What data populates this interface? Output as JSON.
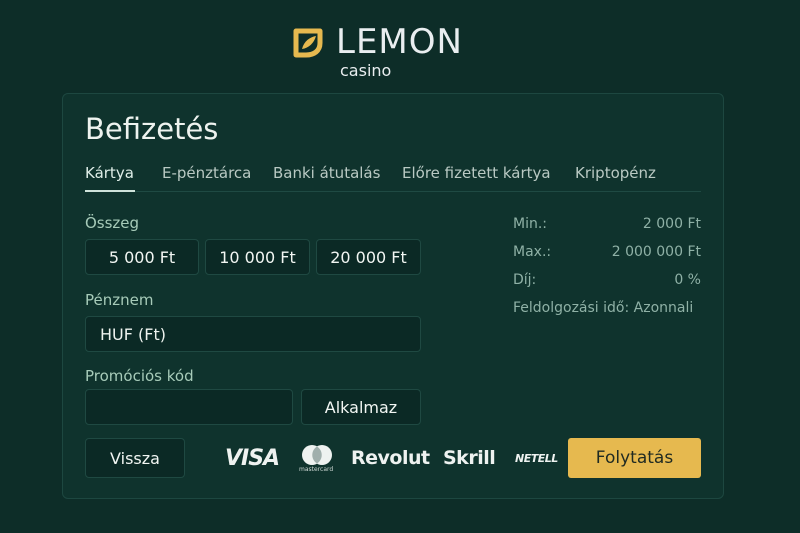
{
  "brand": {
    "name": "LEMON",
    "sub": "casino",
    "accent": "#e6b94f"
  },
  "page": {
    "title": "Befizetés"
  },
  "tabs": [
    {
      "label": "Kártya",
      "active": true
    },
    {
      "label": "E-pénztárca",
      "active": false
    },
    {
      "label": "Banki átutalás",
      "active": false
    },
    {
      "label": "Előre fizetett kártya",
      "active": false
    },
    {
      "label": "Kriptopénz",
      "active": false
    }
  ],
  "amount": {
    "label": "Összeg",
    "options": [
      "5 000 Ft",
      "10 000 Ft",
      "20 000 Ft"
    ]
  },
  "currency": {
    "label": "Pénznem",
    "value": "HUF (Ft)"
  },
  "promo": {
    "label": "Promóciós kód",
    "value": "",
    "apply_label": "Alkalmaz"
  },
  "limits": {
    "min_label": "Min.:",
    "min_value": "2 000 Ft",
    "max_label": "Max.:",
    "max_value": "2 000 000 Ft",
    "fee_label": "Díj:",
    "fee_value": "0 %",
    "processing": "Feldolgozási idő: Azonnali"
  },
  "actions": {
    "back_label": "Vissza",
    "continue_label": "Folytatás"
  },
  "payments": {
    "visa": "VISA",
    "mastercard_text": "mastercard",
    "revolut": "Revolut",
    "skrill": "Skrill",
    "neteller": "NETELL"
  }
}
